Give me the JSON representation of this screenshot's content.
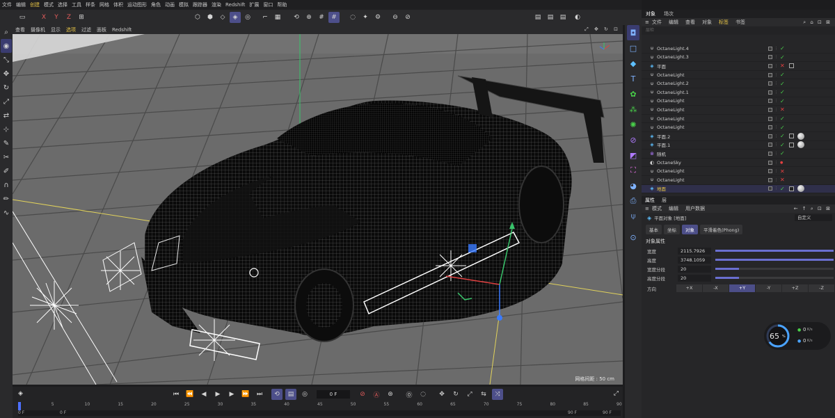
{
  "menubar": {
    "items": [
      "文件",
      "编辑",
      "创建",
      "模式",
      "选择",
      "工具",
      "样条",
      "网格",
      "体积",
      "运动图形",
      "角色",
      "动画",
      "模拟",
      "跟踪器",
      "渲染",
      "Redshift",
      "扩展",
      "窗口",
      "帮助"
    ],
    "highlight_index": 2
  },
  "toolbar": {
    "axes": [
      "X",
      "Y",
      "Z"
    ]
  },
  "viewport_menu": {
    "items": [
      "查看",
      "摄像机",
      "显示",
      "选项",
      "过滤",
      "面板",
      "Redshift"
    ],
    "active_index": 3,
    "status": "网格间距 : 50 cm"
  },
  "timeline": {
    "frame_value": "0 F",
    "ticks": [
      "0",
      "5",
      "10",
      "15",
      "20",
      "25",
      "30",
      "35",
      "40",
      "45",
      "50",
      "55",
      "60",
      "65",
      "70",
      "75",
      "80",
      "85",
      "90"
    ],
    "start_left": "0 F",
    "start_right": "0 F",
    "end_left": "90 F",
    "end_right": "90 F"
  },
  "panel": {
    "tabs": [
      "对象",
      "场次"
    ],
    "menu": [
      "文件",
      "编辑",
      "查看",
      "对象",
      "标签",
      "书签"
    ],
    "menu_active_index": 4,
    "search_placeholder": "层检",
    "objects": [
      {
        "name": "OctaneLight.4",
        "icon": "lamp",
        "status": "check",
        "selected": false
      },
      {
        "name": "OctaneLight.3",
        "icon": "lamp",
        "status": "check",
        "selected": false
      },
      {
        "name": "平面",
        "icon": "plane",
        "status": "cross",
        "selected": false
      },
      {
        "name": "OctaneLight",
        "icon": "lamp",
        "status": "check",
        "selected": false
      },
      {
        "name": "OctaneLight.2",
        "icon": "lamp",
        "status": "check",
        "selected": false
      },
      {
        "name": "OctaneLight.1",
        "icon": "lamp",
        "status": "check",
        "selected": false
      },
      {
        "name": "OctaneLight",
        "icon": "lamp",
        "status": "check",
        "selected": false
      },
      {
        "name": "OctaneLight",
        "icon": "lamp",
        "status": "cross",
        "selected": false
      },
      {
        "name": "OctaneLight",
        "icon": "lamp",
        "status": "check",
        "selected": false
      },
      {
        "name": "OctaneLight",
        "icon": "lamp",
        "status": "check",
        "selected": false
      },
      {
        "name": "平面.2",
        "icon": "plane",
        "status": "check",
        "selected": false
      },
      {
        "name": "平面.1",
        "icon": "plane",
        "status": "check",
        "selected": false
      },
      {
        "name": "随机",
        "icon": "random",
        "status": "check",
        "selected": false
      },
      {
        "name": "OctaneSky",
        "icon": "sky",
        "status": "dot",
        "selected": false
      },
      {
        "name": "OctaneLight",
        "icon": "lamp",
        "status": "cross",
        "selected": false
      },
      {
        "name": "OctaneLight",
        "icon": "lamp",
        "status": "cross",
        "selected": false
      },
      {
        "name": "地面",
        "icon": "plane",
        "status": "check",
        "selected": true
      }
    ]
  },
  "attributes": {
    "tabs": [
      "属性",
      "层"
    ],
    "menu": [
      "模式",
      "编辑",
      "用户数据"
    ],
    "object_label": "平面对象 [地面]",
    "preset": "自定义",
    "subtabs": [
      "基本",
      "坐标",
      "对象",
      "平滑着色(Phong)"
    ],
    "subtab_selected": 2,
    "section": "对象属性",
    "props": [
      {
        "label": "宽度",
        "value": "2115.7926",
        "fill": 1.0
      },
      {
        "label": "高度",
        "value": "3748.1059",
        "fill": 1.0
      },
      {
        "label": "宽度分段",
        "value": "20",
        "fill": 0.2
      },
      {
        "label": "高度分段",
        "value": "20",
        "fill": 0.2
      }
    ],
    "direction_label": "方向",
    "directions": [
      "+X",
      "-X",
      "+Y",
      "-Y",
      "+Z",
      "-Z"
    ],
    "direction_selected": 2
  },
  "monitor": {
    "percent": "65",
    "unit": "%",
    "up": "0",
    "down": "0",
    "rate_unit": "K/s"
  },
  "colors": {
    "accent": "#4d4f8a",
    "check": "#49d14a",
    "cross": "#e34040",
    "highlight": "#e8c546"
  }
}
